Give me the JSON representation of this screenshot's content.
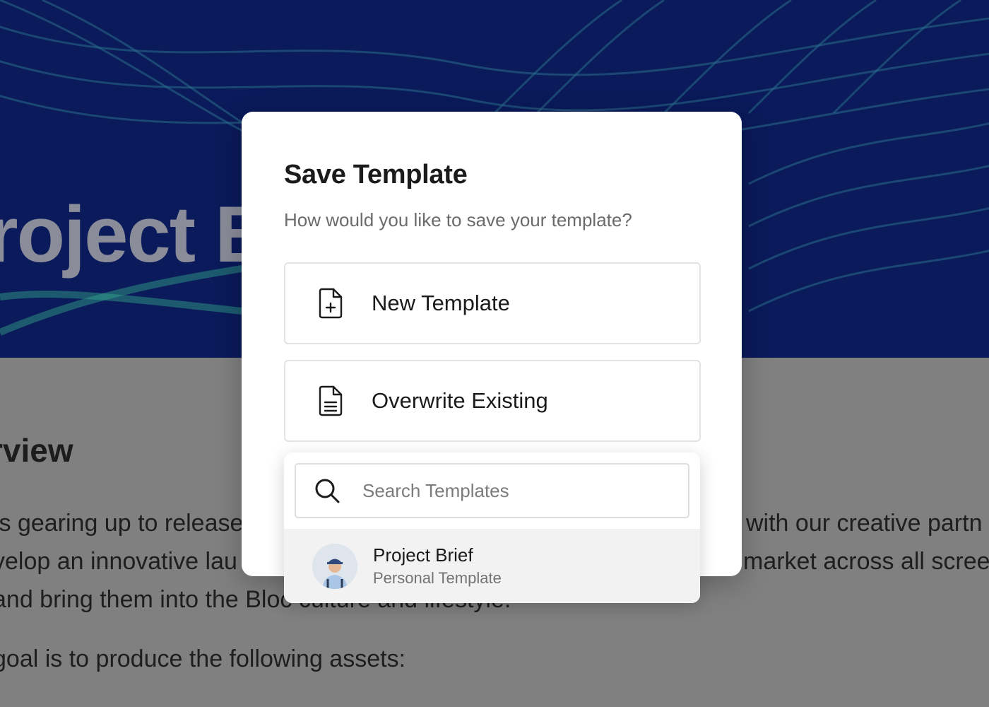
{
  "background": {
    "hero_title": "roject B",
    "section_heading": "rview",
    "paragraph_lines_left": [
      "'s gearing up to release",
      "velop an innovative lau",
      " and bring them into the Bloc culture and lifestyle."
    ],
    "paragraph_lines_right": [
      "with our creative partn",
      "market across all scree"
    ],
    "assets_line": "goal is to produce the following assets:"
  },
  "modal": {
    "title": "Save Template",
    "subtitle": "How would you like to save your template?",
    "options": [
      {
        "label": "New Template",
        "icon": "file-plus-icon"
      },
      {
        "label": "Overwrite Existing",
        "icon": "file-text-icon"
      }
    ]
  },
  "dropdown": {
    "search": {
      "placeholder": "Search Templates",
      "value": "",
      "icon": "search-icon"
    },
    "results": [
      {
        "title": "Project Brief",
        "subtitle": "Personal Template",
        "icon": "avatar"
      }
    ]
  },
  "colors": {
    "hero_bg": "#0a1a5a",
    "overlay": "#808080",
    "accent_wave": "#2f8f8a",
    "text_primary": "#1b1b1b",
    "text_secondary": "#6b6b6b",
    "border": "#e3e3e3",
    "hover_row": "#f2f2f2"
  }
}
